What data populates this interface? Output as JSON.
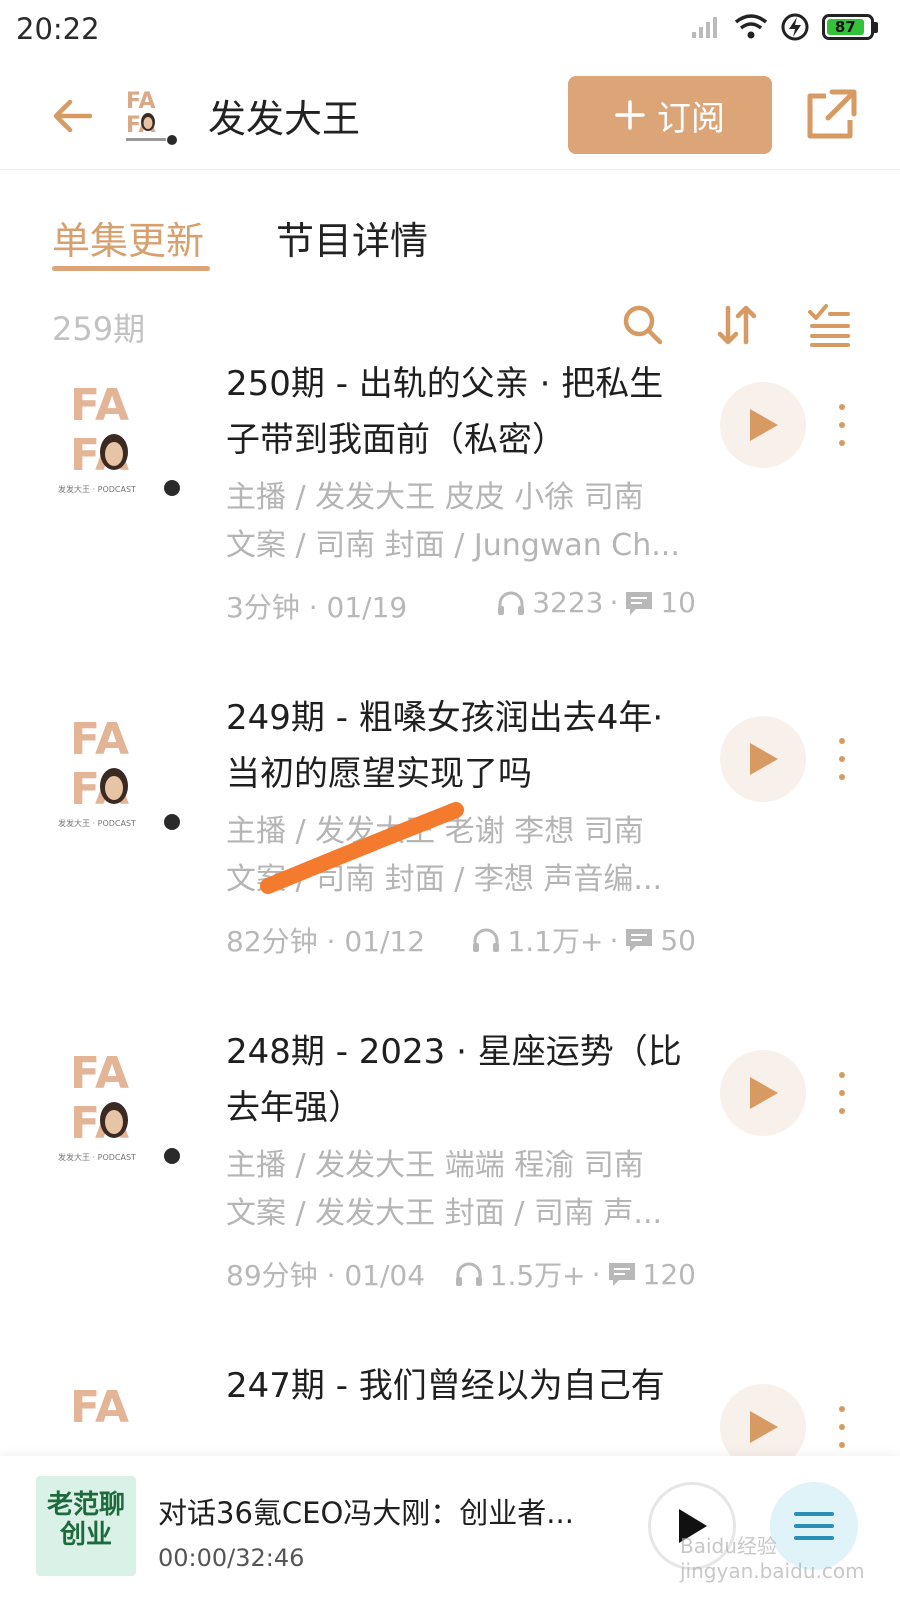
{
  "status_bar": {
    "time": "20:22",
    "battery": "87",
    "icons": [
      "signal-icon",
      "wifi-icon",
      "charging-icon",
      "battery-icon"
    ]
  },
  "header": {
    "title": "发发大王",
    "subscribe_label": "订阅",
    "icons": [
      "back-arrow-icon",
      "podcast-logo",
      "plus-icon",
      "share-icon"
    ]
  },
  "tabs": {
    "episodes": "单集更新",
    "details": "节目详情",
    "active": "episodes"
  },
  "toolbar": {
    "episode_count": "259期",
    "icons": [
      "search-icon",
      "sort-icon",
      "filter-list-icon"
    ]
  },
  "episodes": [
    {
      "title": "250期 - 出轨的父亲 · 把私生子带到我面前（私密）",
      "credits_line1": "主播 / 发发大王 皮皮 小徐 司南",
      "credits_line2": "文案 / 司南 封面 / Jungwan Ch...",
      "duration": "3分钟 · 01/19",
      "plays": "3223",
      "comments": "10"
    },
    {
      "title": "249期 - 粗嗓女孩润出去4年·当初的愿望实现了吗",
      "credits_line1": "主播 / 发发大王 老谢 李想 司南",
      "credits_line2": "文案 / 司南 封面 / 李想 声音编...",
      "duration": "82分钟 · 01/12",
      "plays": "1.1万+",
      "comments": "50"
    },
    {
      "title": "248期 - 2023 · 星座运势（比去年强）",
      "credits_line1": "主播 / 发发大王 端端 程渝 司南",
      "credits_line2": "文案 / 发发大王 封面 / 司南 声...",
      "duration": "89分钟 · 01/04",
      "plays": "1.5万+",
      "comments": "120"
    },
    {
      "title": "247期 - 我们曾经以为自己有",
      "credits_line1": "",
      "credits_line2": "",
      "duration": "",
      "plays": "",
      "comments": ""
    }
  ],
  "cover_text": {
    "line1": "FA",
    "line2": "FA",
    "caption": "发发大王 · PODCAST"
  },
  "mini_player": {
    "cover_text": "老范聊创业",
    "title": "对话36氪CEO冯大刚：创业者...",
    "time": "00:00/32:46"
  },
  "watermark": "Baidu经验 jingyan.baidu.com",
  "colors": {
    "accent": "#dba577",
    "accent_text": "#d7a06f",
    "muted": "#b5b5b5",
    "annotation": "#f47a2e"
  }
}
